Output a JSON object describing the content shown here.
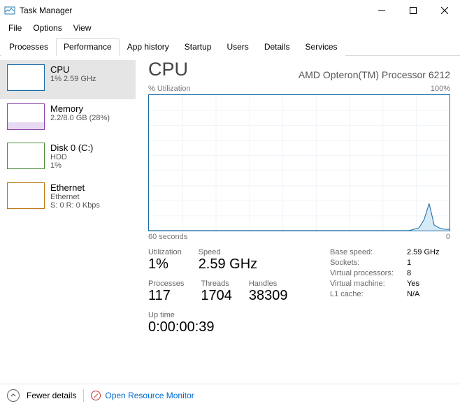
{
  "window": {
    "title": "Task Manager"
  },
  "menu": {
    "file": "File",
    "options": "Options",
    "view": "View"
  },
  "tabs": {
    "processes": "Processes",
    "performance": "Performance",
    "app_history": "App history",
    "startup": "Startup",
    "users": "Users",
    "details": "Details",
    "services": "Services"
  },
  "sidebar": {
    "cpu": {
      "title": "CPU",
      "sub": "1%  2.59 GHz"
    },
    "memory": {
      "title": "Memory",
      "sub": "2.2/8.0 GB (28%)"
    },
    "disk": {
      "title": "Disk 0 (C:)",
      "sub1": "HDD",
      "sub2": "1%"
    },
    "ethernet": {
      "title": "Ethernet",
      "sub1": "Ethernet",
      "sub2": "S: 0 R: 0 Kbps"
    }
  },
  "main": {
    "title": "CPU",
    "subtitle": "AMD Opteron(TM) Processor 6212",
    "chart_y_label": "% Utilization",
    "chart_y_max": "100%",
    "chart_x_label": "60 seconds",
    "chart_x_min": "0"
  },
  "chart_data": {
    "type": "area",
    "title": "% Utilization",
    "xlabel": "60 seconds",
    "ylabel": "% Utilization",
    "ylim": [
      0,
      100
    ],
    "x_range_seconds": [
      60,
      0
    ],
    "values_pct_right_to_left": [
      1,
      1,
      2,
      4,
      20,
      8,
      2,
      1,
      0,
      0,
      0,
      0,
      0,
      0,
      0,
      0,
      0,
      0,
      0,
      0,
      0,
      0,
      0,
      0,
      0,
      0,
      0,
      0,
      0,
      0,
      0,
      0,
      0,
      0,
      0,
      0,
      0,
      0,
      0,
      0,
      0,
      0,
      0,
      0,
      0,
      0,
      0,
      0,
      0,
      0,
      0,
      0,
      0,
      0,
      0,
      0,
      0,
      0,
      0,
      0
    ]
  },
  "stats": {
    "utilization": {
      "label": "Utilization",
      "value": "1%"
    },
    "speed": {
      "label": "Speed",
      "value": "2.59 GHz"
    },
    "processes": {
      "label": "Processes",
      "value": "117"
    },
    "threads": {
      "label": "Threads",
      "value": "1704"
    },
    "handles": {
      "label": "Handles",
      "value": "38309"
    },
    "uptime": {
      "label": "Up time",
      "value": "0:00:00:39"
    },
    "base_speed": {
      "label": "Base speed:",
      "value": "2.59 GHz"
    },
    "sockets": {
      "label": "Sockets:",
      "value": "1"
    },
    "virtual_processors": {
      "label": "Virtual processors:",
      "value": "8"
    },
    "virtual_machine": {
      "label": "Virtual machine:",
      "value": "Yes"
    },
    "l1_cache": {
      "label": "L1 cache:",
      "value": "N/A"
    }
  },
  "footer": {
    "fewer": "Fewer details",
    "resource_monitor": "Open Resource Monitor"
  }
}
